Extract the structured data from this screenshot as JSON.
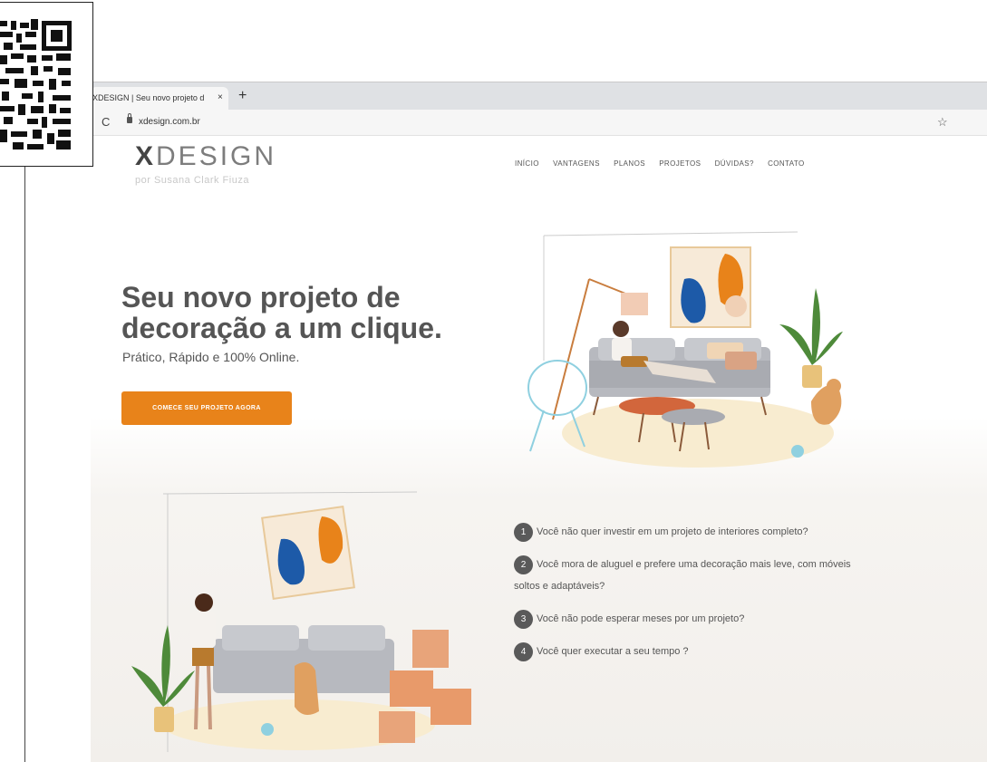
{
  "browser": {
    "tab_title": "XDESIGN | Seu novo projeto d",
    "tab_close": "×",
    "new_tab": "+",
    "reload": "C",
    "url": "xdesign.com.br",
    "star": "☆"
  },
  "site": {
    "logo_x": "X",
    "logo_rest": "DESIGN",
    "logo_sub": "por Susana Clark Fiuza",
    "nav": [
      "INÍCIO",
      "VANTAGENS",
      "PLANOS",
      "PROJETOS",
      "DÚVIDAS?",
      "CONTATO"
    ]
  },
  "hero": {
    "title": "Seu novo projeto de decoração a um clique.",
    "subtitle": "Prático, Rápido e 100% Online.",
    "cta": "COMECE SEU PROJETO AGORA"
  },
  "faq": [
    {
      "num": "1",
      "text": "Você não quer investir em um projeto de interiores completo?"
    },
    {
      "num": "2",
      "text": "Você mora de aluguel e prefere uma decoração mais leve, com móveis soltos e adaptáveis?"
    },
    {
      "num": "3",
      "text": "Você não pode esperar meses por um projeto?"
    },
    {
      "num": "4",
      "text": "Você quer executar a seu tempo ?"
    }
  ],
  "colors": {
    "accent": "#e8831a",
    "text": "#555555",
    "beige": "#f2efeb"
  },
  "icons": [
    "qr-code-icon",
    "reload-icon",
    "lock-icon",
    "star-icon",
    "close-icon",
    "plus-icon"
  ]
}
